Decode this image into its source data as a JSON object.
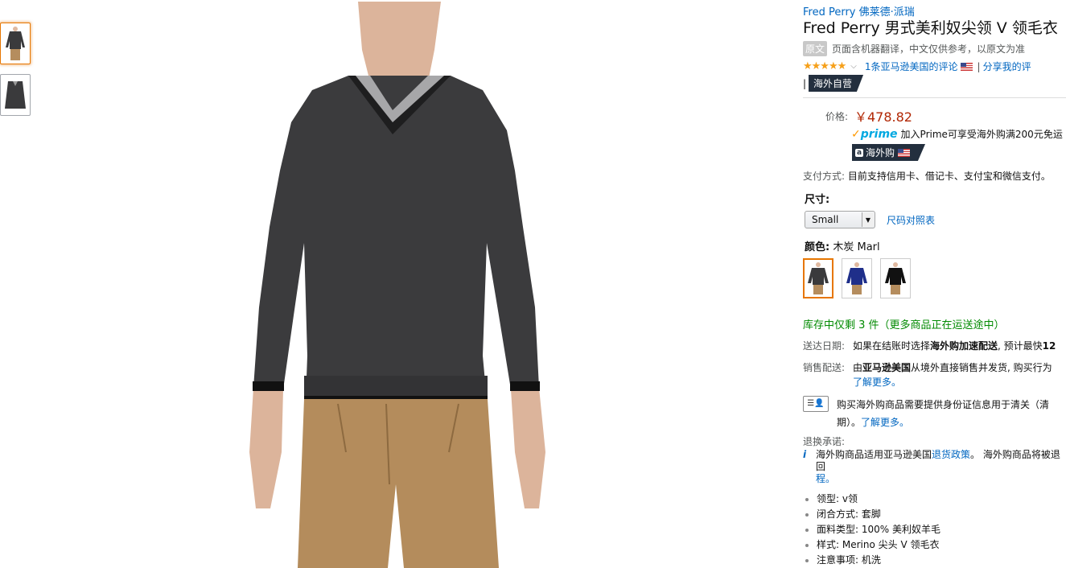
{
  "brand": "Fred Perry 佛莱德·派瑞",
  "title": "Fred Perry 男式美利奴尖领 V 领毛衣",
  "translation": {
    "tag": "原文",
    "note": "页面含机器翻译，中文仅供参考，以原文为准"
  },
  "rating": {
    "stars": "★★★★★",
    "reviews_link": "1条亚马逊美国的评论",
    "separator": "|",
    "share_link": "分享我的评"
  },
  "overseas_badge": {
    "prefix": "|",
    "label": "海外自营"
  },
  "price": {
    "label": "价格:",
    "value": "￥478.82"
  },
  "prime": {
    "logo": "prime",
    "text": "加入Prime可享受海外购满200元免运"
  },
  "haiwaigou_badge": {
    "icon_letter": "a",
    "label": "海外购"
  },
  "payment": {
    "label": "支付方式:",
    "text": "目前支持信用卡、借记卡、支付宝和微信支付。"
  },
  "size": {
    "label": "尺寸:",
    "selected": "Small",
    "chart_link": "尺码对照表"
  },
  "color": {
    "label": "颜色:",
    "value": "木炭 Marl",
    "swatches": [
      "charcoal",
      "navy",
      "black"
    ]
  },
  "stock": "库存中仅剩 3 件（更多商品正在运送途中）",
  "delivery": {
    "label": "送达日期:",
    "text_prefix": "如果在结账时选择",
    "bold_text": "海外购加速配送",
    "text_suffix": ", 预计最快",
    "trailing": "12"
  },
  "seller": {
    "label": "销售配送:",
    "text_prefix": "由",
    "bold_text": "亚马逊美国",
    "text_suffix": "从境外直接销售并发货, 购买行为",
    "learn_more": "了解更多。"
  },
  "id_notice": {
    "line1": "购买海外购商品需要提供身份证信息用于清关（清",
    "line2_prefix": "期）。",
    "learn_more": "了解更多。"
  },
  "returns": {
    "label": "退换承诺:",
    "text_prefix": "海外购商品适用亚马逊美国",
    "policy_link": "退货政策",
    "text_suffix": "。 海外购商品将被退回",
    "line2": "程。"
  },
  "bullets": [
    "领型: v领",
    "闭合方式: 套脚",
    "面料类型: 100% 美利奴羊毛",
    "样式: Merino 尖头 V 领毛衣",
    "注意事项: 机洗"
  ]
}
